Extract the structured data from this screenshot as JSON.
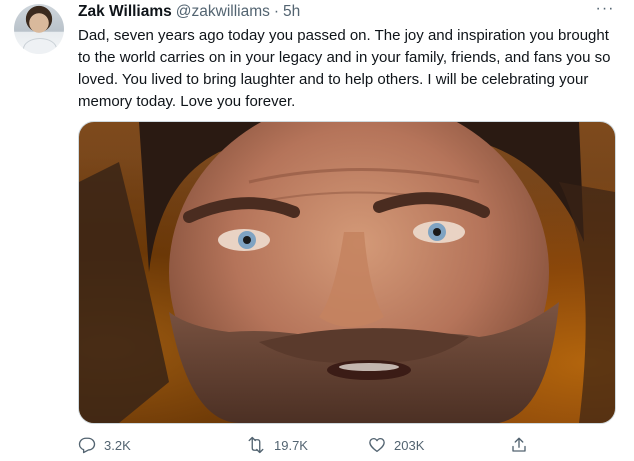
{
  "tweet": {
    "author_name": "Zak Williams",
    "handle": "@zakwilliams",
    "separator": "·",
    "time": "5h",
    "more_label": "···",
    "text": "Dad, seven years ago today you passed on. The joy and inspiration you brought to the world carries on in your legacy and in your family, friends, and fans you so loved. You lived to bring laughter and to help others. I will be celebrating your memory today. Love you forever.",
    "stats": {
      "replies": "3.2K",
      "retweets": "19.7K",
      "likes": "203K"
    }
  },
  "colors": {
    "text_primary": "#0f1419",
    "text_secondary": "#536471",
    "border": "#cfd9de"
  },
  "icons": {
    "reply": "reply-icon",
    "retweet": "retweet-icon",
    "like": "heart-icon",
    "share": "share-icon",
    "more": "more-icon"
  }
}
